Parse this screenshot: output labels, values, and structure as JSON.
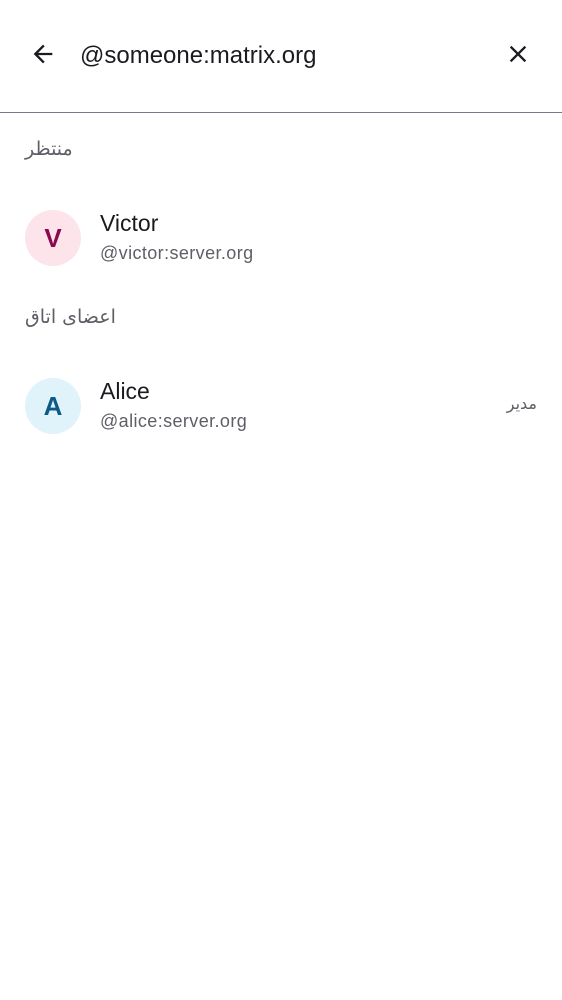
{
  "search": {
    "value": "@someone:matrix.org",
    "back_icon": "arrow-back-icon",
    "clear_icon": "close-icon"
  },
  "sections": [
    {
      "title": "منتظر",
      "members": [
        {
          "initial": "V",
          "name": "Victor",
          "user_id": "@victor:server.org",
          "role": "",
          "avatar_bg": "#fde3ea",
          "avatar_fg": "#8b0a4f"
        }
      ]
    },
    {
      "title": "اعضای اتاق",
      "members": [
        {
          "initial": "A",
          "name": "Alice",
          "user_id": "@alice:server.org",
          "role": "مدیر",
          "avatar_bg": "#e0f2fa",
          "avatar_fg": "#0d5a86"
        }
      ]
    }
  ]
}
